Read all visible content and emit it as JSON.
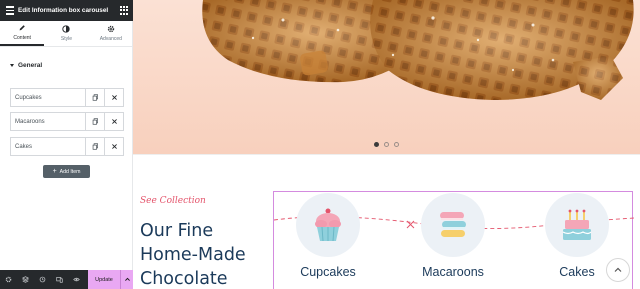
{
  "editor": {
    "title": "Edit Information box carousel",
    "tabs": [
      {
        "label": "Content",
        "icon": "pencil-icon",
        "active": true
      },
      {
        "label": "Style",
        "icon": "contrast-icon",
        "active": false
      },
      {
        "label": "Advanced",
        "icon": "gear-icon",
        "active": false
      }
    ],
    "section_title": "General",
    "items": [
      {
        "label": "Cupcakes"
      },
      {
        "label": "Macaroons"
      },
      {
        "label": "Cakes"
      }
    ],
    "add_item_label": "Add Item",
    "footer": {
      "icons": [
        "settings-icon",
        "layers-icon",
        "history-icon",
        "responsive-icon",
        "preview-eye-icon"
      ],
      "update_label": "Update"
    }
  },
  "preview": {
    "slider_dots": 3,
    "active_dot": 0,
    "tagline": "See Collection",
    "heading": "Our Fine Home-Made Chocolate",
    "cards": [
      {
        "title": "Cupcakes",
        "icon": "cupcake-icon"
      },
      {
        "title": "Macaroons",
        "icon": "macaron-icon"
      },
      {
        "title": "Cakes",
        "icon": "birthday-cake-icon"
      }
    ]
  },
  "colors": {
    "panel_dark": "#26292c",
    "accent_pink": "#e4556c",
    "heading_navy": "#1b3a5a",
    "update_button": "#e9a8f3",
    "carousel_border": "#d48bdf"
  }
}
